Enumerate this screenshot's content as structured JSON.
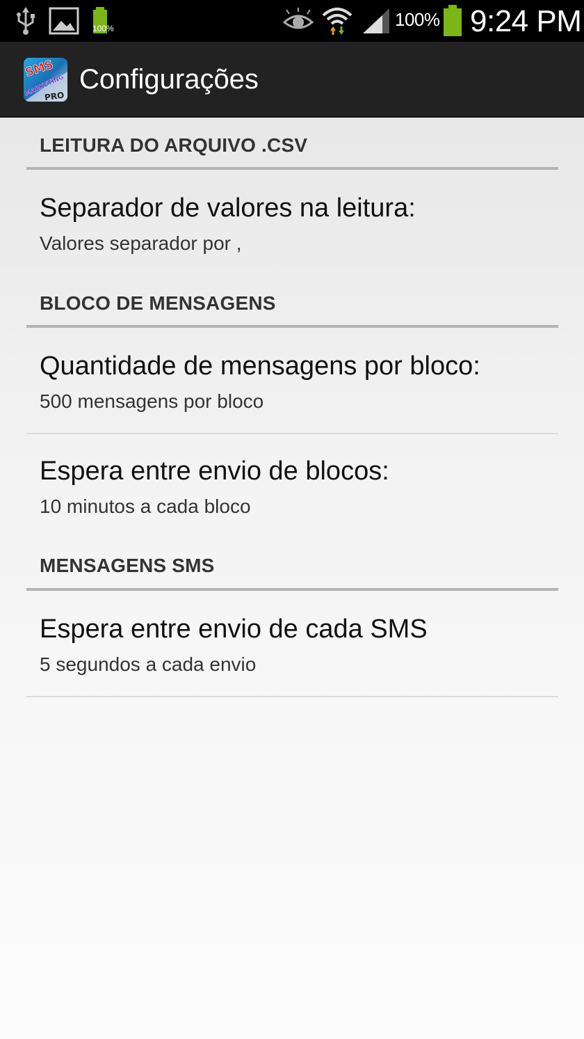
{
  "status_bar": {
    "battery_percent_text": "100%",
    "small_battery_text": "100%",
    "time": "9:24 PM",
    "icons": [
      "usb-icon",
      "image-icon",
      "battery-small-icon",
      "eye-icon",
      "wifi-icon",
      "signal-icon",
      "battery-icon"
    ],
    "accent": "#7cb518"
  },
  "action_bar": {
    "title": "Configurações",
    "app_icon_lines": [
      "SMS",
      "MARKETING",
      "PRO"
    ]
  },
  "sections": [
    {
      "header": "LEITURA DO ARQUIVO .CSV",
      "items": [
        {
          "title": "Separador de valores na leitura:",
          "summary": "Valores separador por ,"
        }
      ]
    },
    {
      "header": "BLOCO DE MENSAGENS",
      "items": [
        {
          "title": "Quantidade de mensagens por bloco:",
          "summary": "500 mensagens por bloco"
        },
        {
          "title": "Espera entre envio de blocos:",
          "summary": "10 minutos a cada bloco"
        }
      ]
    },
    {
      "header": "MENSAGENS SMS",
      "items": [
        {
          "title": "Espera entre envio de cada SMS",
          "summary": "5 segundos a cada envio"
        }
      ]
    }
  ]
}
